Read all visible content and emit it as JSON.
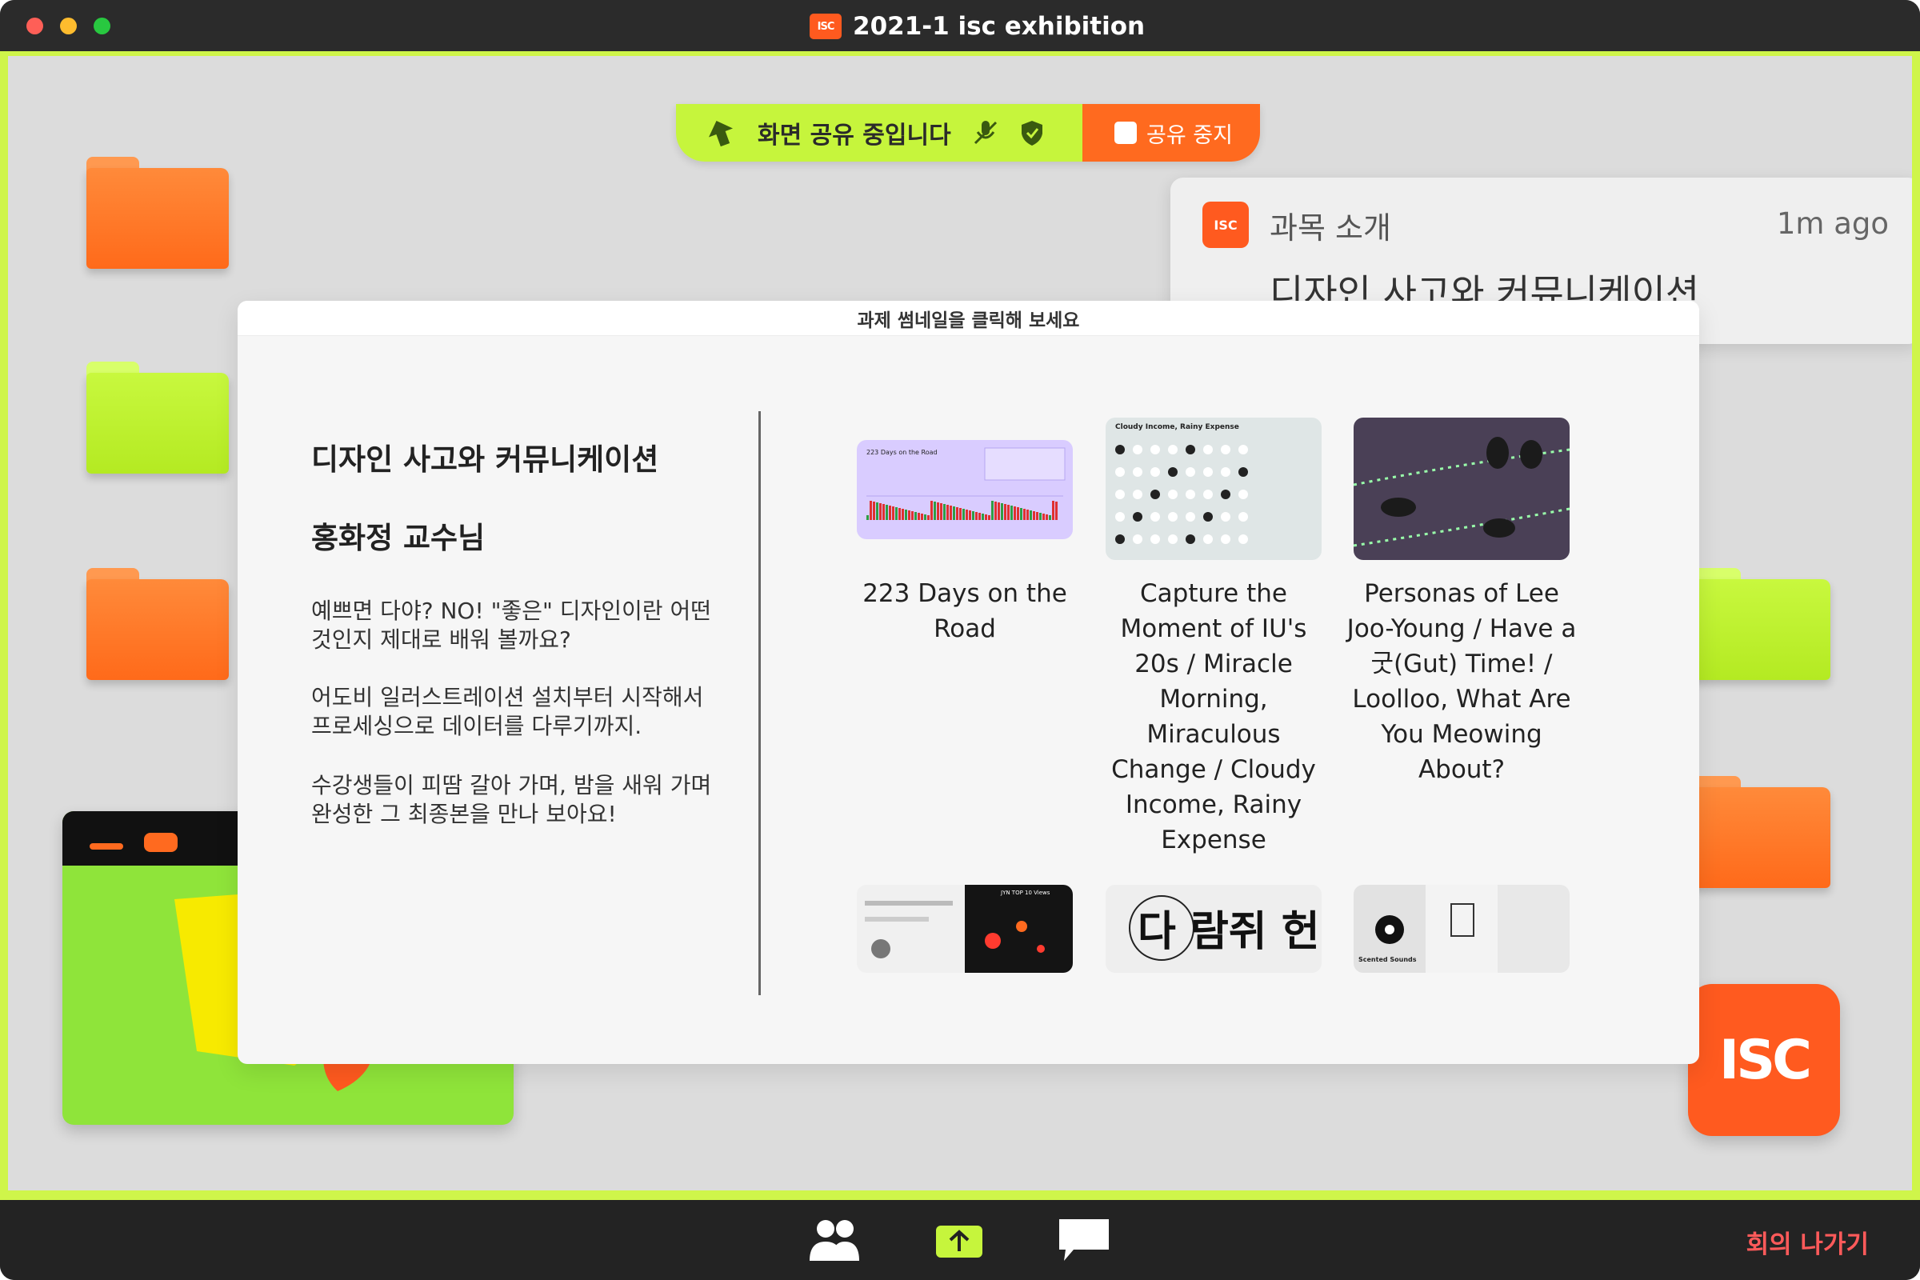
{
  "window": {
    "title": "2021-1 isc exhibition",
    "logo_text": "ISC"
  },
  "share_bar": {
    "label": "화면 공유 중입니다",
    "stop_label": "공유 중지"
  },
  "notification": {
    "title": "과목 소개",
    "time": "1m ago",
    "body": "디자인 사고와 커뮤니케이션",
    "logo_text": "ISC"
  },
  "panel": {
    "header": "과제 썸네일을 클릭해 보세요",
    "course_title": "디자인 사고와 커뮤니케이션",
    "professor": "홍화정 교수님",
    "description": [
      "예쁘면 다야? NO! \"좋은\" 디자인이란 어떤 것인지 제대로 배워 볼까요?",
      "어도비 일러스트레이션 설치부터 시작해서 프로세싱으로 데이터를 다루기까지.",
      "수강생들이 피땀 갈아 가며, 밤을 새워 가며 완성한 그 최종본을 만나 보아요!"
    ],
    "projects": [
      {
        "title": "223 Days on the Road",
        "thumb_label": "223 Days on the Road"
      },
      {
        "title": "Capture the Moment of IU's 20s / Miracle Morning, Miraculous Change / Cloudy Income, Rainy Expense",
        "thumb_label": "Cloudy Income, Rainy Expense"
      },
      {
        "title": "Personas of Lee Joo-Young / Have a 굿(Gut) Time! / Loolloo, What Are You Meowing About?"
      },
      {
        "title": "",
        "thumb_label": "JYN TOP 10 Views"
      },
      {
        "title": "",
        "thumb_label": "다 람쥐 헌 쳇바퀴에"
      },
      {
        "title": "",
        "thumb_label": "Scented Sounds"
      }
    ]
  },
  "big_logo_text": "ISC",
  "toolbar": {
    "leave_label": "회의 나가기"
  },
  "colors": {
    "lime": "#c6f53c",
    "orange": "#ff6a1f",
    "titlebar": "#2b2b2b",
    "leave_red": "#ff5a5a"
  },
  "icons": [
    "participants-icon",
    "share-screen-icon",
    "chat-icon",
    "mic-off-icon",
    "shield-icon",
    "arrow-up-icon"
  ]
}
